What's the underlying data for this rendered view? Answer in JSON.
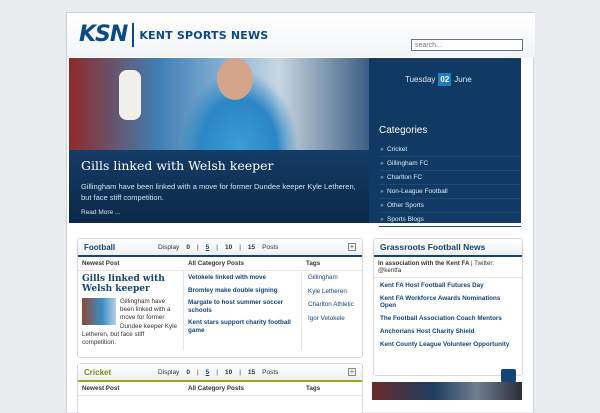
{
  "header": {
    "logo_mark": "KSN",
    "logo_text": "KENT SPORTS NEWS",
    "search_placeholder": "search..."
  },
  "hero": {
    "title": "Gills linked with Welsh keeper",
    "summary": "Gillingham have been linked with a move for former Dundee keeper Kyle Letheren, but face stiff competition.",
    "read_more": "Read More ..."
  },
  "date": {
    "weekday": "Tuesday",
    "day": "02",
    "month": "June"
  },
  "categories": {
    "title": "Categories",
    "items": [
      "Cricket",
      "Gillingham FC",
      "Charlton FC",
      "Non-League Football",
      "Other Sports",
      "Sports Blogs"
    ]
  },
  "football": {
    "title": "Football",
    "display_label": "Display",
    "display_options": [
      "0",
      "5",
      "10",
      "15"
    ],
    "selected_option": "5",
    "posts_label": "Posts",
    "col_newest": "Newest Post",
    "col_all": "All Category Posts",
    "col_tags": "Tags",
    "newest_title": "Gills linked with Welsh keeper",
    "newest_text": "Gillingham have been linked with a move for former Dundee keeper Kyle Letheren, but face stiff competition.",
    "all_posts": [
      "Vetokele linked with move",
      "Bromley make double signing",
      "Margate to host summer soccer schools",
      "Kent stars support charity football game"
    ],
    "tags": [
      "Gillingham",
      "Kyle Letheren",
      "Charlton Athletic",
      "Igor Vetokele"
    ]
  },
  "cricket": {
    "title": "Cricket",
    "display_label": "Display",
    "display_options": [
      "0",
      "5",
      "10",
      "15"
    ],
    "selected_option": "5",
    "posts_label": "Posts",
    "col_newest": "Newest Post",
    "col_all": "All Category Posts",
    "col_tags": "Tags"
  },
  "grassroots": {
    "title": "Grassroots Football News",
    "assoc": "In association with the Kent FA",
    "twitter": "| Twitter: @kentfa",
    "items": [
      "Kent FA Host Football Futures Day",
      "Kent FA Workforce Awards Nominations Open",
      "The Football Association Coach Mentors",
      "Anchorians Host Charity Shield",
      "Kent County League Volunteer Opportunity"
    ]
  },
  "colors": {
    "brand_blue": "#13447a",
    "hero_dark": "#0e3156",
    "cricket_green": "#9aa71f"
  }
}
